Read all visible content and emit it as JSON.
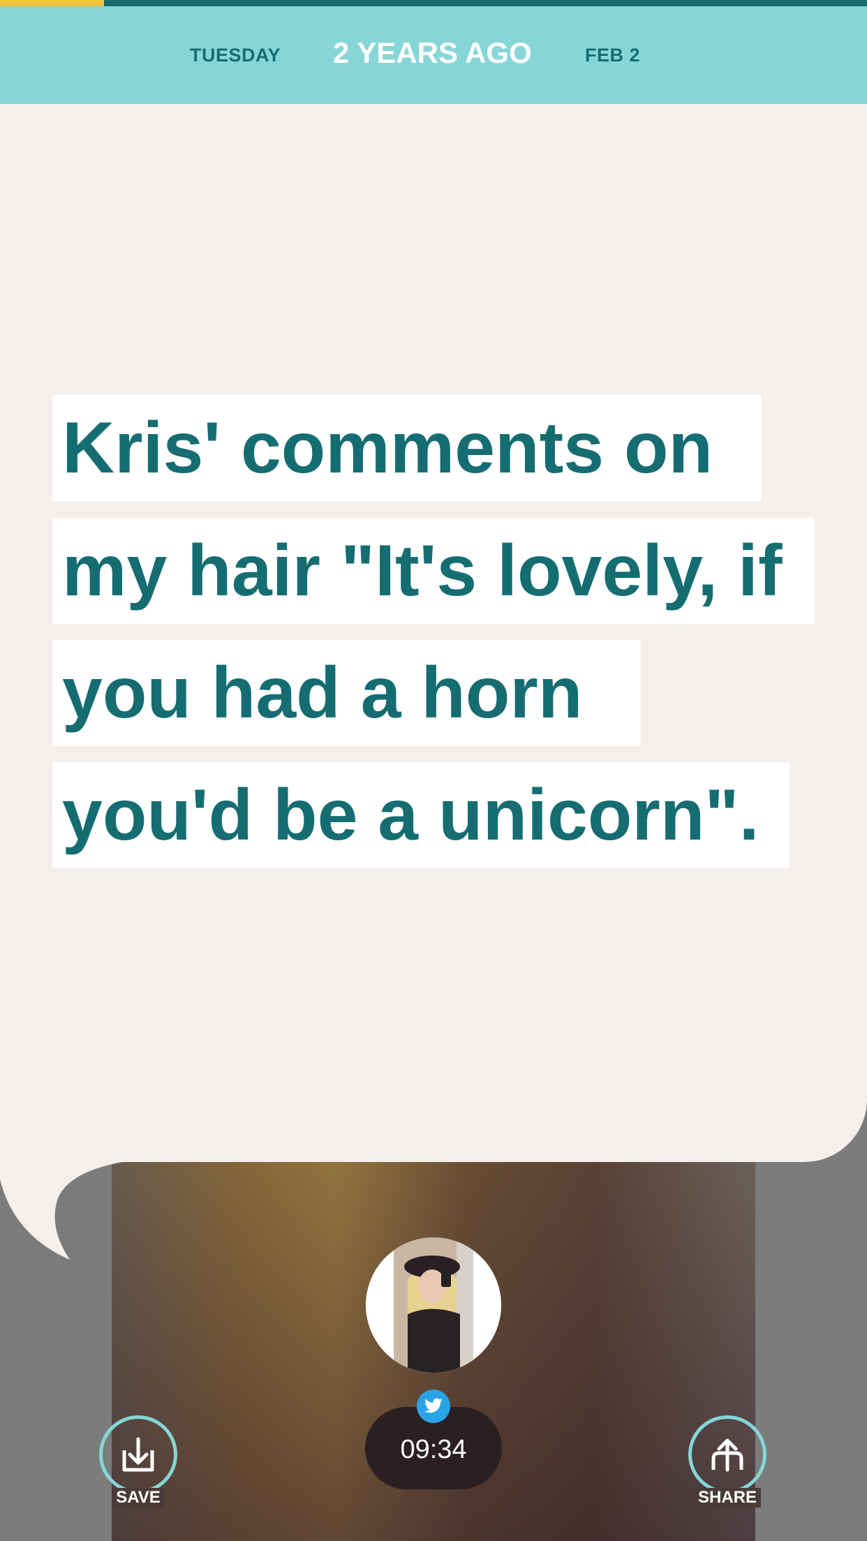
{
  "progress": {
    "fraction": 0.12,
    "fill_color": "#f2c53d",
    "track_color": "#146b70"
  },
  "header": {
    "day": "TUESDAY",
    "relative_time": "2 YEARS AGO",
    "date": "FEB 2",
    "background": "#86d6d8"
  },
  "post": {
    "quote_lines": [
      "Kris' comments on",
      "my hair \"It's lovely, if",
      "you had a horn",
      "you'd be a unicorn\"."
    ],
    "text_color": "#156d72",
    "source_icon": "twitter-icon",
    "time": "09:34"
  },
  "actions": {
    "save_label": "SAVE",
    "save_icon": "save-download-icon",
    "share_label": "SHARE",
    "share_icon": "share-upload-icon"
  },
  "avatar": {
    "icon": "user-photo-avatar"
  }
}
